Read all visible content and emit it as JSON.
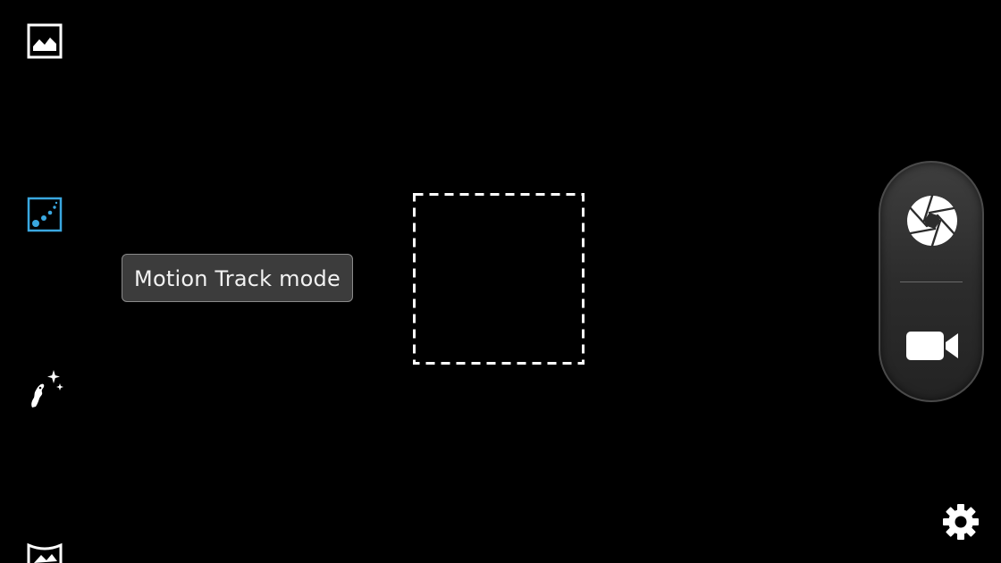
{
  "tooltip": {
    "text": "Motion Track mode"
  },
  "left_toolbar": {
    "items": [
      {
        "icon": "gallery-icon"
      },
      {
        "icon": "motion-track-icon",
        "active": true
      },
      {
        "icon": "beautify-icon"
      },
      {
        "icon": "panorama-icon"
      }
    ]
  },
  "capture_controls": {
    "photo_icon": "shutter-icon",
    "video_icon": "video-camera-icon"
  },
  "settings": {
    "icon": "gear-icon"
  },
  "colors": {
    "background": "#000000",
    "accent": "#3aa8e0",
    "icon": "#ffffff",
    "tooltip_bg": "#3c3c3c"
  }
}
